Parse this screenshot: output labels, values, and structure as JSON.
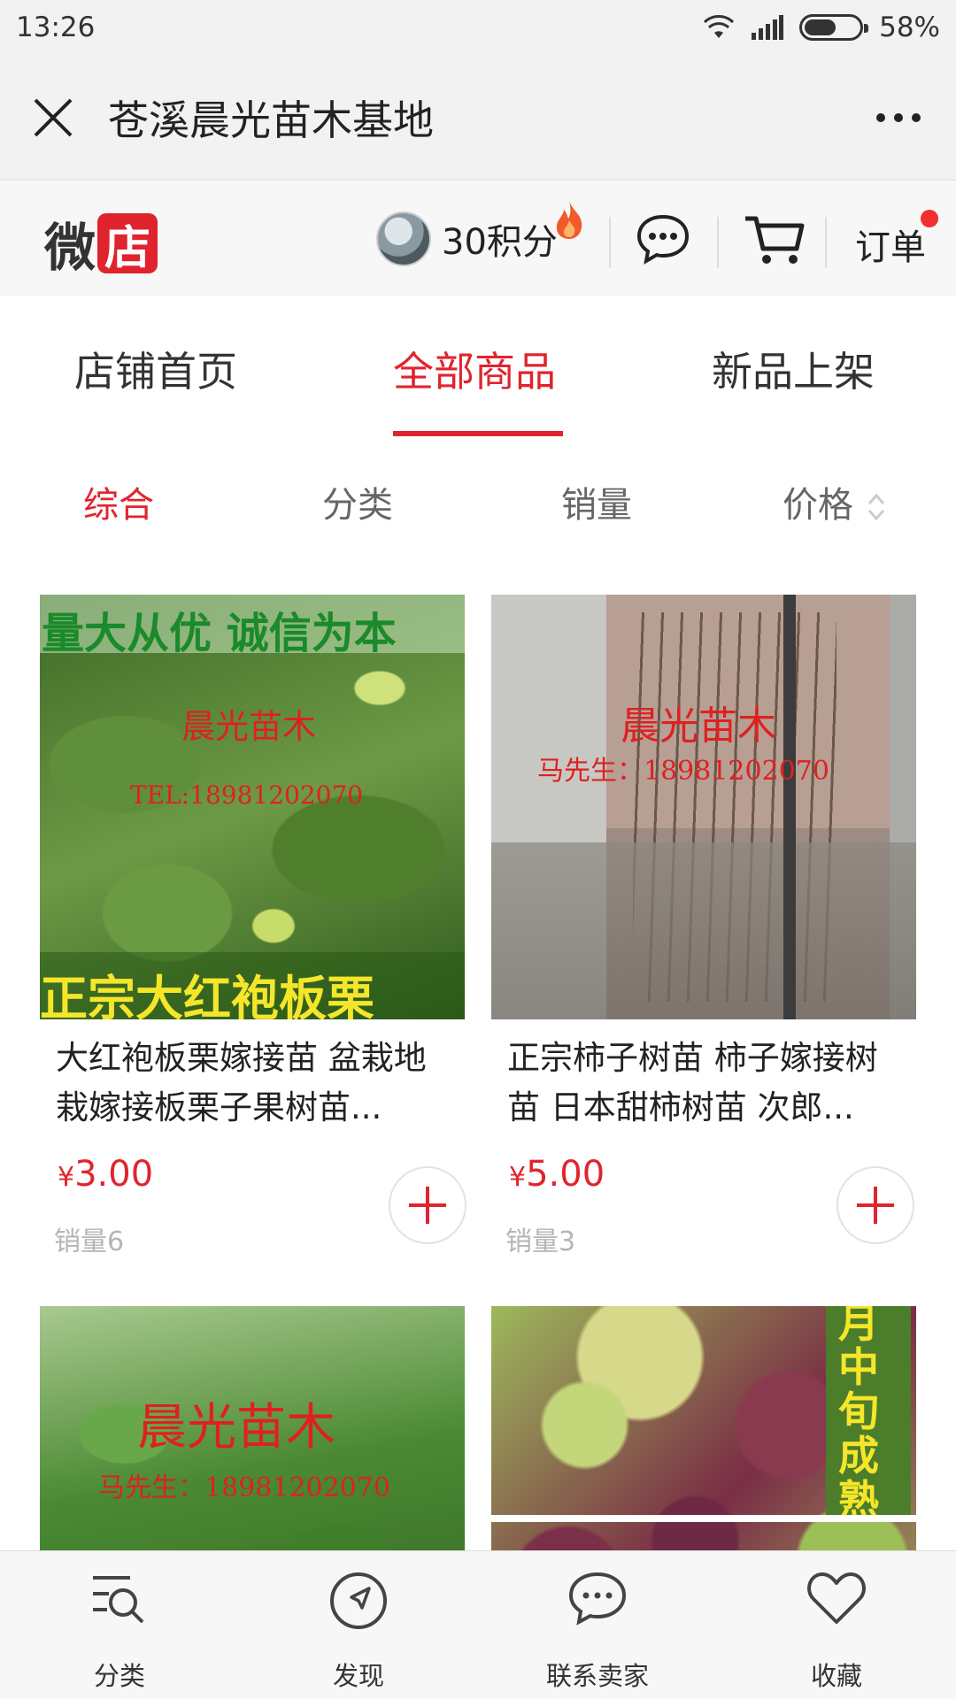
{
  "status_bar": {
    "time": "13:26",
    "battery": "58%",
    "battery_level": 0.58
  },
  "title_bar": {
    "title": "苍溪晨光苗木基地"
  },
  "shop_header": {
    "logo_text_1": "微",
    "logo_text_2": "店",
    "points": "30积分",
    "order_label": "订单"
  },
  "tabs": [
    {
      "label": "店铺首页",
      "active": false
    },
    {
      "label": "全部商品",
      "active": true
    },
    {
      "label": "新品上架",
      "active": false
    }
  ],
  "sort_options": [
    {
      "label": "综合",
      "active": true
    },
    {
      "label": "分类",
      "active": false
    },
    {
      "label": "销量",
      "active": false
    },
    {
      "label": "价格",
      "active": false
    }
  ],
  "products": [
    {
      "title": "大红袍板栗嫁接苗 盆栽地栽嫁接板栗子果树苗...",
      "currency": "¥",
      "price": "3.00",
      "sales": "销量6",
      "img_top_text": "量大从优  诚信为本",
      "img_brand": "晨光苗木",
      "img_tel": "TEL:18981202070",
      "img_bottom_text": "正宗大红袍板栗"
    },
    {
      "title": "正宗柿子树苗 柿子嫁接树苗 日本甜柿树苗 次郎...",
      "currency": "¥",
      "price": "5.00",
      "sales": "销量3",
      "img_brand": "晨光苗木",
      "img_tel": "马先生：18981202070"
    },
    {
      "img_brand": "晨光苗木",
      "img_tel": "马先生：18981202070"
    },
    {
      "img_side_text": "月中旬成熟"
    }
  ],
  "bottom_nav": [
    {
      "label": "分类",
      "icon": "category-search-icon"
    },
    {
      "label": "发现",
      "icon": "compass-icon"
    },
    {
      "label": "联系卖家",
      "icon": "chat-icon"
    },
    {
      "label": "收藏",
      "icon": "heart-icon"
    }
  ],
  "colors": {
    "accent": "#e0242e",
    "text": "#222222",
    "muted": "#b5b5b5"
  }
}
